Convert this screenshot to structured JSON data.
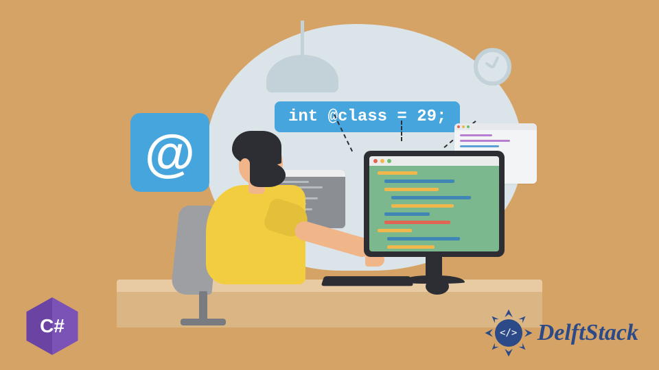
{
  "illustration": {
    "at_symbol": "@",
    "code_label": "int @class = 29;"
  },
  "logos": {
    "csharp_text": "C#",
    "delft_text": "DelftStack",
    "delft_glyph": "</>"
  },
  "colors": {
    "background": "#d6a367",
    "blob": "#dbe5e9",
    "accent_blue": "#46a5dd",
    "shirt": "#f3cd40",
    "dark": "#2d2e34",
    "screen": "#7cb88e",
    "csharp_purple": "#6a43a3",
    "delft_blue": "#2b4a87"
  }
}
